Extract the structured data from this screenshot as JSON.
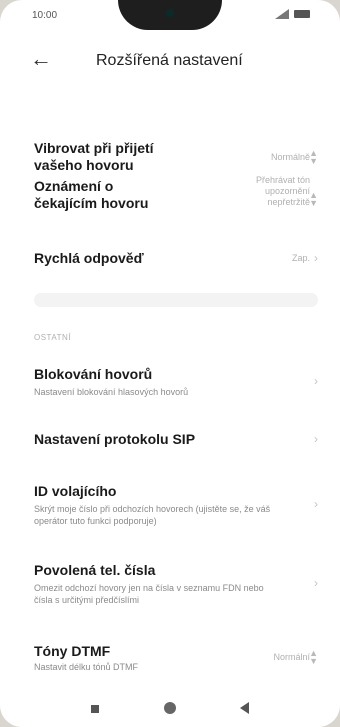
{
  "status": {
    "time": "10:00"
  },
  "header": {
    "title": "Rozšířená nastavení"
  },
  "rows": [
    {
      "label": "Vibrovat při přijetí vašeho hovoru",
      "value": "Normálně"
    },
    {
      "label": "Oznámení o čekajícím hovoru",
      "value": "Přehrávat tón upozornění nepřetržitě"
    },
    {
      "label": "Rychlá odpověď",
      "value": "Zap."
    }
  ],
  "section": {
    "label": "OSTATNÍ"
  },
  "other_rows": [
    {
      "label": "Blokování hovorů",
      "sub": "Nastavení blokování hlasových hovorů"
    },
    {
      "label": "Nastavení protokolu SIP"
    },
    {
      "label": "ID volajícího",
      "sub": "Skrýt moje číslo při odchozích hovorech (ujistěte se, že váš operátor tuto funkci podporuje)"
    },
    {
      "label": "Povolená tel. čísla",
      "sub": "Omezit odchozí hovory jen na čísla v seznamu FDN nebo čísla s určitými předčíslími"
    },
    {
      "label": "Tóny DTMF",
      "sub": "Nastavit délku tónů DTMF",
      "value": "Normální"
    }
  ],
  "icons": {
    "back": "arrow-left-icon",
    "chevron": "chevron-right-icon",
    "updown": "updown-icon"
  }
}
